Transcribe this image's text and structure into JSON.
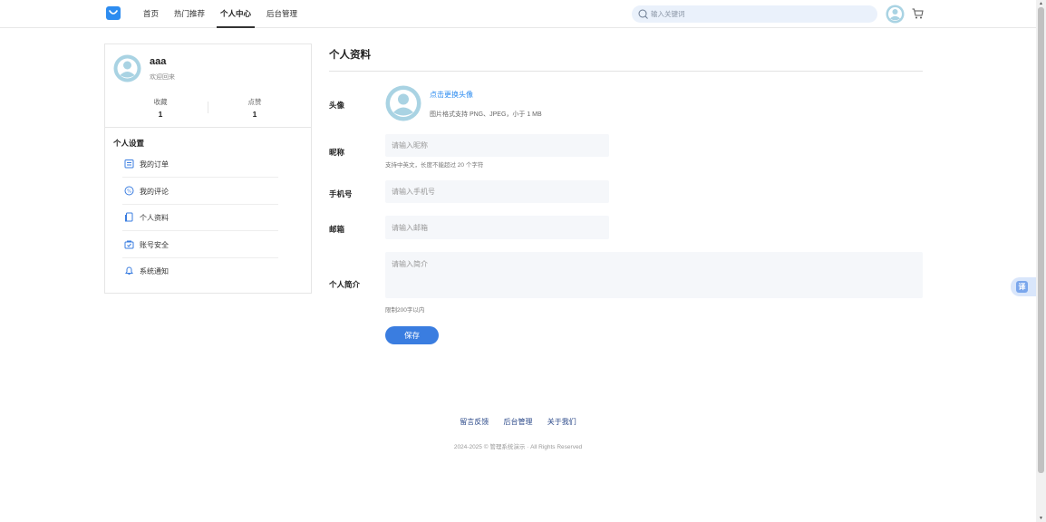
{
  "nav": {
    "items": [
      {
        "label": "首页",
        "active": false
      },
      {
        "label": "热门推荐",
        "active": false
      },
      {
        "label": "个人中心",
        "active": true
      },
      {
        "label": "后台管理",
        "active": false
      }
    ]
  },
  "search": {
    "placeholder": "输入关键词"
  },
  "profile": {
    "name": "aaa",
    "welcome": "欢迎回来",
    "stats": [
      {
        "label": "收藏",
        "value": "1"
      },
      {
        "label": "点赞",
        "value": "1"
      }
    ],
    "section_title": "个人设置",
    "menu": [
      {
        "label": "我的订单",
        "icon": "order-icon"
      },
      {
        "label": "我的评论",
        "icon": "comment-icon"
      },
      {
        "label": "个人资料",
        "icon": "profile-doc-icon"
      },
      {
        "label": "账号安全",
        "icon": "security-icon"
      },
      {
        "label": "系统通知",
        "icon": "bell-icon"
      }
    ]
  },
  "form": {
    "title": "个人资料",
    "avatar_label": "头像",
    "change_avatar": "点击更换头像",
    "avatar_hint": "图片格式支持 PNG、JPEG，小于 1 MB",
    "nickname_label": "昵称",
    "nickname_placeholder": "请输入昵称",
    "nickname_hint": "支持中英文，长度不能超过 20 个字符",
    "phone_label": "手机号",
    "phone_placeholder": "请输入手机号",
    "email_label": "邮箱",
    "email_placeholder": "请输入邮箱",
    "bio_label": "个人简介",
    "bio_placeholder": "请输入简介",
    "bio_hint": "限制200字以内",
    "save": "保存"
  },
  "footer": {
    "links": [
      "留言反馈",
      "后台管理",
      "关于我们"
    ],
    "copyright": "2024-2025 © 管理系统演示 · All Rights Reserved"
  },
  "translate": {
    "label": "译"
  },
  "colors": {
    "accent": "#2d8cf0",
    "button": "#3a7de0",
    "avatar": "#a9d3e3"
  }
}
